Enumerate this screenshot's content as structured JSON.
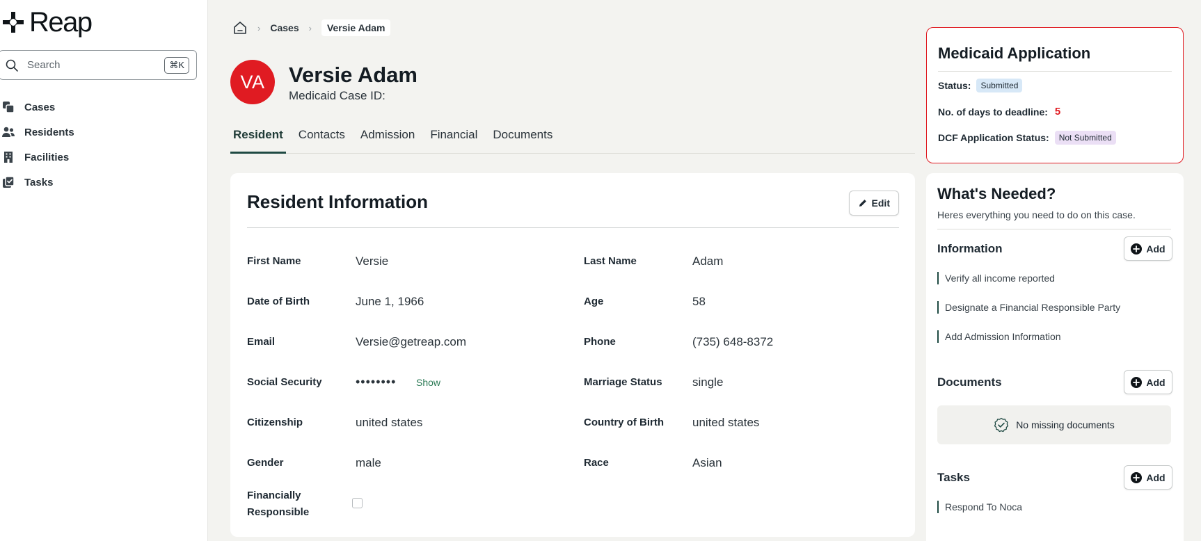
{
  "brand": {
    "name": "Reap"
  },
  "search": {
    "placeholder": "Search",
    "shortcut": "⌘K"
  },
  "sidebar": {
    "items": [
      {
        "label": "Cases",
        "icon": "cases-icon"
      },
      {
        "label": "Residents",
        "icon": "residents-icon"
      },
      {
        "label": "Facilities",
        "icon": "facilities-icon"
      },
      {
        "label": "Tasks",
        "icon": "tasks-icon"
      }
    ]
  },
  "breadcrumb": {
    "home_icon": "home-icon",
    "cases": "Cases",
    "current": "Versie Adam"
  },
  "resident": {
    "initials": "VA",
    "name": "Versie Adam",
    "case_id_label": "Medicaid Case ID:",
    "avatar_color": "#e01b22"
  },
  "tabs": [
    {
      "label": "Resident",
      "active": true
    },
    {
      "label": "Contacts"
    },
    {
      "label": "Admission"
    },
    {
      "label": "Financial"
    },
    {
      "label": "Documents"
    }
  ],
  "resident_info": {
    "title": "Resident Information",
    "edit_label": "Edit",
    "fields": {
      "first_name": {
        "label": "First Name",
        "value": "Versie"
      },
      "last_name": {
        "label": "Last Name",
        "value": "Adam"
      },
      "dob": {
        "label": "Date of Birth",
        "value": "June 1, 1966"
      },
      "age": {
        "label": "Age",
        "value": "58"
      },
      "email": {
        "label": "Email",
        "value": "Versie@getreap.com"
      },
      "phone": {
        "label": "Phone",
        "value": "(735) 648-8372"
      },
      "ssn": {
        "label": "Social Security",
        "value": "••••••••",
        "show_label": "Show"
      },
      "marriage": {
        "label": "Marriage Status",
        "value": "single"
      },
      "citizenship": {
        "label": "Citizenship",
        "value": "united states"
      },
      "country_birth": {
        "label": "Country of Birth",
        "value": "united states"
      },
      "gender": {
        "label": "Gender",
        "value": "male"
      },
      "race": {
        "label": "Race",
        "value": "Asian"
      },
      "financially_responsible": {
        "label_line1": "Financially",
        "label_line2": "Responsible",
        "checked": false
      }
    }
  },
  "medicaid_application": {
    "title": "Medicaid Application",
    "status_label": "Status:",
    "status_value": "Submitted",
    "deadline_label": "No. of days to deadline:",
    "deadline_value": "5",
    "dcf_label": "DCF Application Status:",
    "dcf_value": "Not Submitted",
    "accent_color": "#e01b22"
  },
  "whats_needed": {
    "title": "What's Needed?",
    "subtitle": "Heres everything you need to do on this case.",
    "information": {
      "title": "Information",
      "add_label": "Add",
      "items": [
        "Verify all income reported",
        "Designate a Financial Responsible Party",
        "Add Admission Information"
      ]
    },
    "documents": {
      "title": "Documents",
      "add_label": "Add",
      "empty_text": "No missing documents"
    },
    "tasks": {
      "title": "Tasks",
      "add_label": "Add",
      "items": [
        "Respond To Noca"
      ]
    }
  }
}
